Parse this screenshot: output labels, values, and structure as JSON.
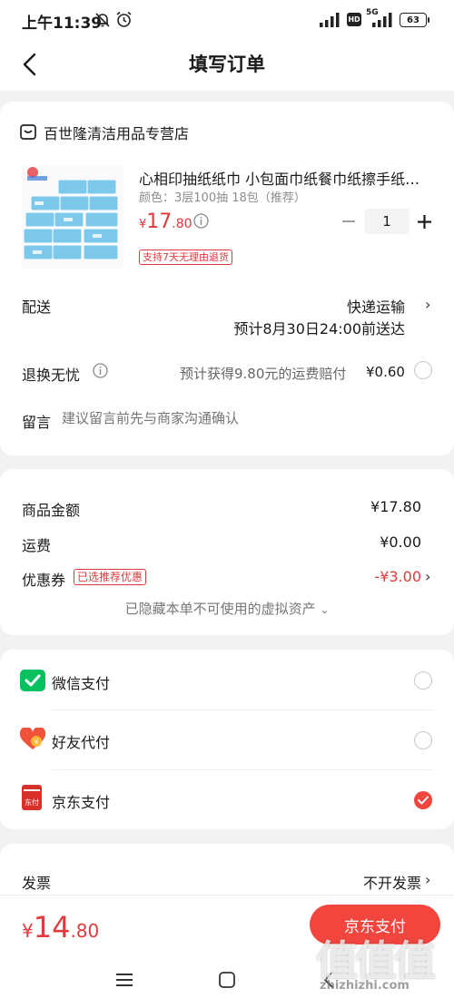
{
  "status_bar": {
    "time": "上午11:39",
    "network": "5G",
    "hd": "HD",
    "battery": "63"
  },
  "nav": {
    "title": "填写订单"
  },
  "store": {
    "name": "百世隆清洁用品专营店"
  },
  "product": {
    "name": "心相印抽纸纸巾 小包面巾纸餐巾纸擦手纸…",
    "spec": "颜色：3层100抽 18包（推荐）",
    "price_symbol": "¥",
    "price_int": "17",
    "price_dec": ".80",
    "quantity": "1",
    "return_tag": "支持7天无理由退货"
  },
  "delivery": {
    "label": "配送",
    "method": "快递运输",
    "eta": "预计8月30日24:00前送达"
  },
  "return_insurance": {
    "label": "退换无忧",
    "desc": "预计获得9.80元的运费赔付",
    "price": "¥0.60"
  },
  "message": {
    "label": "留言",
    "placeholder": "建议留言前先与商家沟通确认"
  },
  "summary": {
    "goods_label": "商品金额",
    "goods_value": "¥17.80",
    "shipping_label": "运费",
    "shipping_value": "¥0.00",
    "coupon_label": "优惠券",
    "coupon_tag": "已选推荐优惠",
    "coupon_value": "-¥3.00",
    "hidden_assets": "已隐藏本单不可使用的虚拟资产"
  },
  "payment": {
    "options": [
      {
        "label": "微信支付",
        "icon": "wechat-pay-icon",
        "selected": false
      },
      {
        "label": "好友代付",
        "icon": "friend-pay-icon",
        "selected": false
      },
      {
        "label": "京东支付",
        "icon": "jd-pay-icon",
        "selected": true
      }
    ],
    "jd_icon_text": "东付"
  },
  "invoice": {
    "label": "发票",
    "value": "不开发票"
  },
  "bottom_bar": {
    "symbol": "¥",
    "total_int": "14",
    "total_dec": ".80",
    "pay_button": "京东支付"
  },
  "watermark": {
    "logo": "值值值",
    "url": "zhizhizhi.com"
  },
  "colors": {
    "accent": "#e4393c",
    "pay_button": "#f2453d",
    "wechat_green": "#07c160"
  }
}
